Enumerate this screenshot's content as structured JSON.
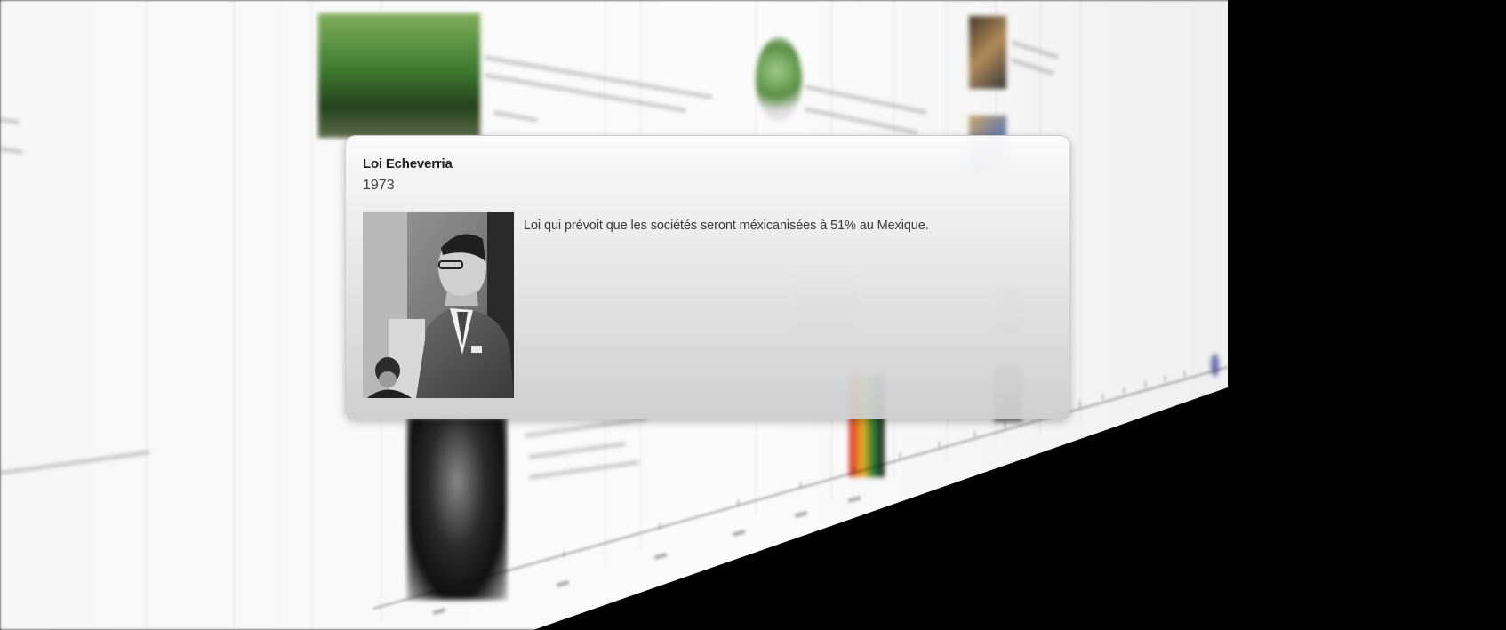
{
  "popup": {
    "title": "Loi Echeverria",
    "date": "1973",
    "description": "Loi qui prévoit que les sociétés seront méxicanisées à 51% au Mexique.",
    "photo_icon": "black-and-white-portrait-photo"
  },
  "background": {
    "image_icons": [
      "forest-photo",
      "globe-south-america-icon",
      "crowd-photo",
      "portrait-photo",
      "flag-photo"
    ]
  },
  "colors": {
    "page_background": "#000000",
    "wall": "#f7f7f7",
    "popup_top": "#fafafa",
    "popup_bottom": "#cdcdcd",
    "title_text": "#1e1e1e",
    "body_text": "#3a3a3a"
  }
}
